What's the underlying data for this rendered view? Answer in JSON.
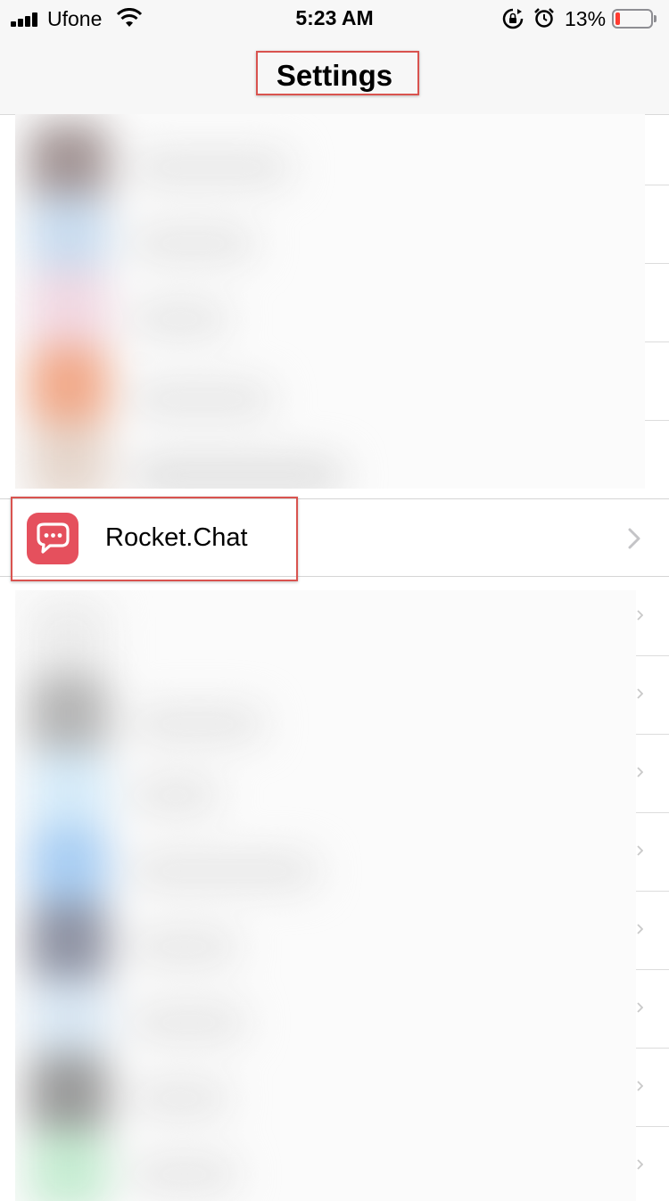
{
  "status_bar": {
    "carrier": "Ufone",
    "time": "5:23 AM",
    "battery_percent": "13%",
    "battery_level": 0.13,
    "icons": [
      "signal-bars-icon",
      "wifi-icon",
      "rotation-lock-icon",
      "alarm-icon",
      "battery-icon"
    ]
  },
  "nav": {
    "title": "Settings"
  },
  "highlighted_row": {
    "label": "Rocket.Chat",
    "icon": "rocket-chat-icon",
    "icon_color": "#e5505d"
  },
  "annotations": {
    "highlight_color": "#d9534f"
  }
}
